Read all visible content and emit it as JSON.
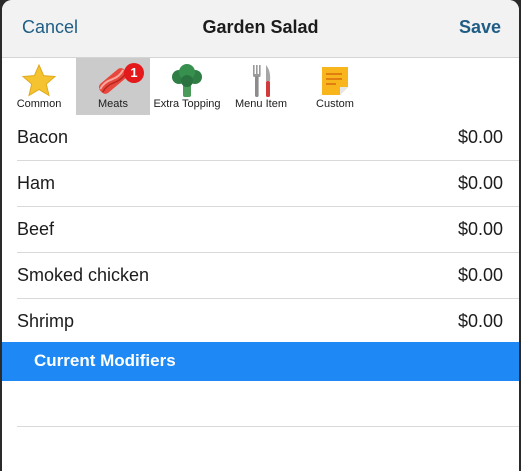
{
  "navbar": {
    "cancel_label": "Cancel",
    "title": "Garden Salad",
    "save_label": "Save",
    "accent_color": "#1f5d84"
  },
  "categories": [
    {
      "label": "Common",
      "icon": "star-icon",
      "selected": false
    },
    {
      "label": "Meats",
      "icon": "bacon-icon",
      "selected": true,
      "badge": "1"
    },
    {
      "label": "Extra Topping",
      "icon": "broccoli-icon",
      "selected": false
    },
    {
      "label": "Menu Item",
      "icon": "fork-knife-icon",
      "selected": false
    },
    {
      "label": "Custom",
      "icon": "sticky-note-icon",
      "selected": false
    }
  ],
  "modifiers": [
    {
      "name": "Bacon",
      "price": "$0.00"
    },
    {
      "name": "Ham",
      "price": "$0.00"
    },
    {
      "name": "Beef",
      "price": "$0.00"
    },
    {
      "name": "Smoked chicken",
      "price": "$0.00"
    },
    {
      "name": "Shrimp",
      "price": "$0.00"
    }
  ],
  "current_modifiers": {
    "header": "Current Modifiers",
    "header_color": "#1e88f5",
    "items": []
  }
}
